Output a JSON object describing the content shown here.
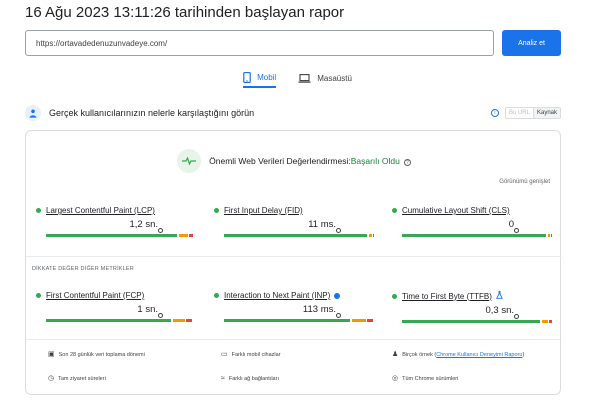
{
  "report": {
    "title": "16 Ağu 2023 13:11:26 tarihinden başlayan rapor"
  },
  "search": {
    "url": "https://ortavadedenuzunvadeye.com/",
    "button": "Analiz et"
  },
  "tabs": [
    {
      "label": "Mobil",
      "icon": "smartphone-icon",
      "active": true
    },
    {
      "label": "Masaüstü",
      "icon": "laptop-icon",
      "active": false
    }
  ],
  "section": {
    "title": "Gerçek kullanıcılarınızın nelerle karşılaştığını görün",
    "toggle_off": "Bu URL",
    "toggle_on": "Kaynak"
  },
  "cwv": {
    "label": "Önemli Web Verileri Değerlendirmesi:",
    "status": "Başarılı Oldu",
    "expand": "Görünümü genişlet"
  },
  "metrics": [
    {
      "name": "Largest Contentful Paint (LCP)",
      "value": "1,2 sn.",
      "good": 0.87,
      "ni": 0.06,
      "poor": 0.03,
      "marker": 0.76
    },
    {
      "name": "First Input Delay (FID)",
      "value": "11 ms.",
      "good": 0.97,
      "ni": 0.02,
      "poor": 0.01,
      "marker": 0.76
    },
    {
      "name": "Cumulative Layout Shift (CLS)",
      "value": "0",
      "good": 0.98,
      "ni": 0.01,
      "poor": 0.01,
      "marker": 0.76
    }
  ],
  "other_label": "DİKKATE DEĞER DİĞER METRİKLER",
  "other_metrics": [
    {
      "name": "First Contentful Paint (FCP)",
      "value": "1 sn.",
      "good": 0.83,
      "ni": 0.08,
      "poor": 0.04,
      "marker": 0.76
    },
    {
      "name": "Interaction to Next Paint (INP)",
      "value": "113 ms.",
      "good": 0.84,
      "ni": 0.09,
      "poor": 0.04,
      "marker": 0.76
    },
    {
      "name": "Time to First Byte (TTFB)",
      "value": "0,3 sn.",
      "good": 0.93,
      "ni": 0.04,
      "poor": 0.02,
      "marker": 0.76
    }
  ],
  "footer": {
    "period": "Son 28 günlük veri toplama dönemi",
    "devices": "Farklı mobil cihazlar",
    "samples_prefix": "Birçok örnek (",
    "samples_link": "Chrome Kullanıcı Deneyimi Raporu",
    "samples_suffix": ")",
    "visits": "Tam ziyaret süreleri",
    "network": "Farklı ağ bağlantıları",
    "chrome": "Tüm Chrome sürümleri"
  },
  "colors": {
    "accent": "#1a73e8",
    "good": "#34a853",
    "needs_improvement": "#f29900",
    "poor": "#ea4335"
  }
}
